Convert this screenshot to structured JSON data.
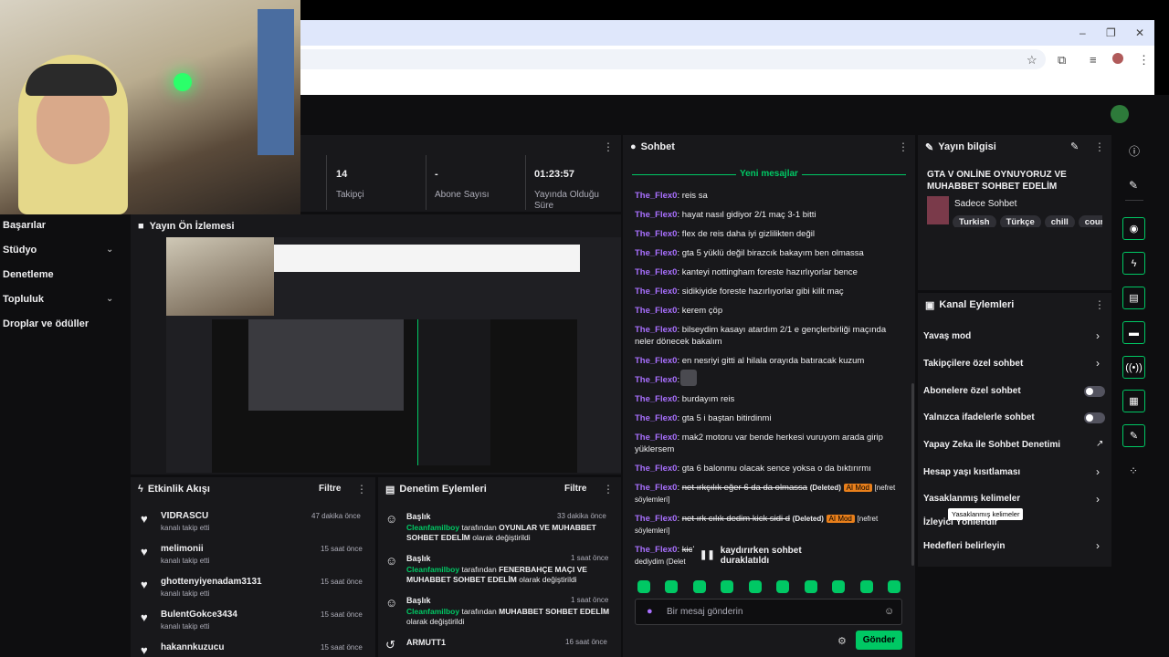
{
  "browser": {
    "window_controls": [
      "–",
      "❐",
      "✕"
    ],
    "toolbar_icons": [
      "star-icon",
      "extension-icon",
      "media-icon",
      "profile-icon",
      "menu-icon"
    ]
  },
  "sidebar": {
    "items": [
      {
        "label": "Başarılar",
        "chevron": false
      },
      {
        "label": "Stüdyo",
        "chevron": true
      },
      {
        "label": "Denetleme",
        "chevron": false
      },
      {
        "label": "Topluluk",
        "chevron": true
      },
      {
        "label": "Droplar ve ödüller",
        "chevron": false
      }
    ]
  },
  "stats": [
    {
      "value": "14",
      "label": "Takipçi"
    },
    {
      "value": "-",
      "label": "Abone Sayısı"
    },
    {
      "value": "01:23:57",
      "label": "Yayında Olduğu Süre"
    }
  ],
  "preview": {
    "title": "Yayın Ön İzlemesi"
  },
  "chat": {
    "title": "Sohbet",
    "new_messages": "Yeni mesajlar",
    "paused": "kaydırırken sohbet duraklatıldı",
    "input_placeholder": "Bir mesaj gönderin",
    "send_label": "Gönder",
    "messages": [
      {
        "user": "The_Flex0",
        "text": "reis sa"
      },
      {
        "user": "The_Flex0",
        "text": "hayat nasıl gidiyor 2/1 maç 3-1 bitti"
      },
      {
        "user": "The_Flex0",
        "text": "flex de reis daha iyi gizlilikten değil"
      },
      {
        "user": "The_Flex0",
        "text": "gta 5 yüklü değil birazcık bakayım ben olmassa"
      },
      {
        "user": "The_Flex0",
        "text": "kanteyi nottingham foreste hazırlıyorlar bence"
      },
      {
        "user": "The_Flex0",
        "text": "sidikiyide foreste hazırlıyorlar gibi kilit maç"
      },
      {
        "user": "The_Flex0",
        "text": "kerem çöp"
      },
      {
        "user": "The_Flex0",
        "text": "bilseydim kasayı atardım 2/1 e gençlerbirliği maçında neler dönecek bakalım"
      },
      {
        "user": "The_Flex0",
        "text": "en nesriyi gitti al hilala orayıda batıracak kuzum"
      },
      {
        "user": "The_Flex0",
        "text": ""
      },
      {
        "user": "The_Flex0",
        "text": "burdayım reis"
      },
      {
        "user": "The_Flex0",
        "text": "gta 5 i baştan bitirdinmi"
      },
      {
        "user": "The_Flex0",
        "text": "mak2 motoru var bende herkesi vuruyom arada girip yüklersem"
      },
      {
        "user": "The_Flex0",
        "text": "gta 6 balonmu olacak sence yoksa o da bıktırırmı"
      }
    ],
    "deleted_messages": [
      {
        "user": "The_Flex0",
        "text": "net ırkçılık eğer 6 da da olmassa",
        "deleted": "(Deleted)",
        "badge": "AI Mod",
        "reason": "[nefret söylemleri]"
      },
      {
        "user": "The_Flex0",
        "text": "net ırk cılık dedim kick sidi d",
        "deleted": "(Deleted)",
        "badge": "AI Mod",
        "reason": "[nefret söylemleri]"
      },
      {
        "user": "The_Flex0",
        "text": "kick",
        "deleted": "",
        "badge": "",
        "reason": "dediydim (Delet"
      }
    ]
  },
  "stream_info": {
    "title": "Yayın bilgisi",
    "stream_title": "GTA V ONLİNE OYNUYORUZ VE MUHABBET SOHBET EDELİM",
    "category": "Sadece Sohbet",
    "tags": [
      "Turkish",
      "Türkçe",
      "chill",
      "count"
    ]
  },
  "channel_actions": {
    "title": "Kanal Eylemleri",
    "items": [
      {
        "label": "Yavaş mod",
        "control": "chevron"
      },
      {
        "label": "Takipçilere özel sohbet",
        "control": "chevron"
      },
      {
        "label": "Abonelere özel sohbet",
        "control": "toggle"
      },
      {
        "label": "Yalnızca ifadelerle sohbet",
        "control": "toggle"
      },
      {
        "label": "Yapay Zeka ile Sohbet Denetimi",
        "control": "external"
      },
      {
        "label": "Hesap yaşı kısıtlaması",
        "control": "chevron"
      },
      {
        "label": "Yasaklanmış kelimeler",
        "control": "chevron"
      },
      {
        "label": "İzleyici Yönlendir",
        "control": "none"
      },
      {
        "label": "Hedefleri belirleyin",
        "control": "chevron"
      }
    ],
    "tooltip": "Yasaklanmış kelimeler"
  },
  "activity": {
    "title": "Etkinlik Akışı",
    "filter": "Filtre",
    "items": [
      {
        "name": "VIDRASCU",
        "sub": "kanalı takip etti",
        "time": "47 dakika önce"
      },
      {
        "name": "melimonii",
        "sub": "kanalı takip etti",
        "time": "15 saat önce"
      },
      {
        "name": "ghottenyiyenadam3131",
        "sub": "kanalı takip etti",
        "time": "15 saat önce"
      },
      {
        "name": "BulentGokce3434",
        "sub": "kanalı takip etti",
        "time": "15 saat önce"
      },
      {
        "name": "hakannkuzucu",
        "sub": "",
        "time": "15 saat önce"
      }
    ]
  },
  "mod_actions": {
    "title": "Denetim Eylemleri",
    "filter": "Filtre",
    "items": [
      {
        "title": "Başlık",
        "user": "Cleanfamilboy",
        "mid": "tarafından",
        "value": "OYUNLAR VE MUHABBET SOHBET EDELİM",
        "end": "olarak değiştirildi",
        "time": "33 dakika önce"
      },
      {
        "title": "Başlık",
        "user": "Cleanfamilboy",
        "mid": "tarafından",
        "value": "FENERBAHÇE MAÇI VE MUHABBET SOHBET EDELİM",
        "end": "olarak değiştirildi",
        "time": "1 saat önce"
      },
      {
        "title": "Başlık",
        "user": "Cleanfamilboy",
        "mid": "tarafından",
        "value": "MUHABBET SOHBET EDELİM",
        "end": "olarak değiştirildi",
        "time": "1 saat önce"
      },
      {
        "title": "ARMUTT1",
        "user": "",
        "mid": "",
        "value": "",
        "end": "",
        "time": "16 saat önce"
      }
    ]
  },
  "colors": {
    "accent": "#00c864",
    "username": "#a970ff",
    "ai_mod": "#e87f1b",
    "panel": "#18181b",
    "bg": "#0e0e10"
  }
}
